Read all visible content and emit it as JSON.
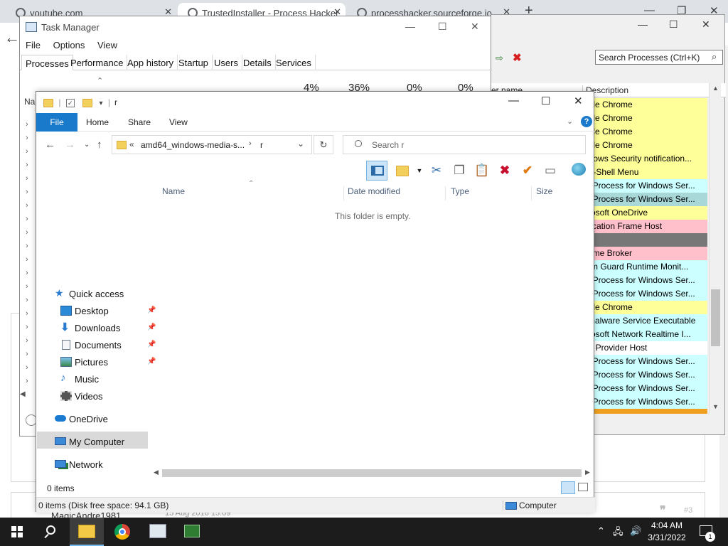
{
  "browser": {
    "tabs": [
      {
        "title": "youtube.com"
      },
      {
        "title": "TrustedInstaller - Process Hacker"
      },
      {
        "title": "processhacker.sourceforge.io"
      }
    ],
    "new_tab": "+",
    "comment_user": "MagicAndre1981",
    "comment_date": "15 Aug 2016 15:09",
    "comment_num": "#3"
  },
  "process_hacker": {
    "search_placeholder": "Search Processes (Ctrl+K)",
    "col_user": "er name",
    "col_desc": "Description",
    "rows": [
      {
        "text": "ogle Chrome",
        "color": "#ffff99"
      },
      {
        "text": "ogle Chrome",
        "color": "#ffff99"
      },
      {
        "text": "ogle Chrome",
        "color": "#ffff99"
      },
      {
        "text": "ogle Chrome",
        "color": "#ffff99"
      },
      {
        "text": "ndows Security notification...",
        "color": "#ffff99"
      },
      {
        "text": "en-Shell Menu",
        "color": "#ffff99"
      },
      {
        "text": "st Process for Windows Ser...",
        "color": "#ccffff"
      },
      {
        "text": "st Process for Windows Ser...",
        "color": "#a8d8d8"
      },
      {
        "text": "crosoft OneDrive",
        "color": "#ffff99"
      },
      {
        "text": "plication Frame Host",
        "color": "#ffc0cb"
      },
      {
        "text": "re",
        "color": "#777777"
      },
      {
        "text": "ntime Broker",
        "color": "#ffc0cb"
      },
      {
        "text": "tem Guard Runtime Monit...",
        "color": "#ccffff"
      },
      {
        "text": "st Process for Windows Ser...",
        "color": "#ccffff"
      },
      {
        "text": "st Process for Windows Ser...",
        "color": "#ccffff"
      },
      {
        "text": "ogle Chrome",
        "color": "#ffff99"
      },
      {
        "text": "timalware Service Executable",
        "color": "#ccffff"
      },
      {
        "text": "crosoft Network Realtime I...",
        "color": "#ccffff"
      },
      {
        "text": "MI Provider Host",
        "color": "#ffffff"
      },
      {
        "text": "st Process for Windows Ser...",
        "color": "#ccffff"
      },
      {
        "text": "st Process for Windows Ser...",
        "color": "#ccffff"
      },
      {
        "text": "st Process for Windows Ser...",
        "color": "#ccffff"
      },
      {
        "text": "st Process for Windows Ser...",
        "color": "#ccffff"
      },
      {
        "text": "",
        "color": "#f0a020"
      }
    ]
  },
  "task_manager": {
    "title": "Task Manager",
    "menu": [
      "File",
      "Options",
      "View"
    ],
    "tabs": [
      "Processes",
      "Performance",
      "App history",
      "Startup",
      "Users",
      "Details",
      "Services"
    ],
    "percents": [
      "4%",
      "36%",
      "0%",
      "0%"
    ],
    "name_col": "Na"
  },
  "explorer": {
    "title": "r",
    "ribbon": {
      "file": "File",
      "home": "Home",
      "share": "Share",
      "view": "View"
    },
    "address": {
      "crumb1": "amd64_windows-media-s...",
      "crumb2": "r",
      "prefix": "«"
    },
    "search_placeholder": "Search r",
    "nav": {
      "quick_access": "Quick access",
      "desktop": "Desktop",
      "downloads": "Downloads",
      "documents": "Documents",
      "pictures": "Pictures",
      "music": "Music",
      "videos": "Videos",
      "onedrive": "OneDrive",
      "my_computer": "My Computer",
      "network": "Network"
    },
    "columns": {
      "name": "Name",
      "date": "Date modified",
      "type": "Type",
      "size": "Size"
    },
    "empty": "This folder is empty.",
    "status_count": "0 items",
    "bottom_info": "0 items (Disk free space: 94.1 GB)",
    "bottom_computer": "Computer"
  },
  "taskbar": {
    "time": "4:04 AM",
    "date": "3/31/2022",
    "notifications": "1"
  }
}
